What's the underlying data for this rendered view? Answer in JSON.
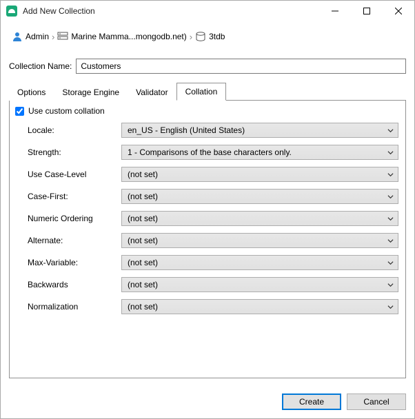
{
  "window": {
    "title": "Add New Collection"
  },
  "breadcrumb": {
    "user": "Admin",
    "server": "Marine Mamma...mongodb.net)",
    "db": "3tdb"
  },
  "nameRow": {
    "label": "Collection Name:",
    "value": "Customers"
  },
  "tabs": {
    "options": "Options",
    "storageEngine": "Storage Engine",
    "validator": "Validator",
    "collation": "Collation"
  },
  "collation": {
    "useCustom": "Use custom collation",
    "fields": {
      "locale": {
        "label": "Locale:",
        "value": "en_US - English (United States)"
      },
      "strength": {
        "label": "Strength:",
        "value": "1 - Comparisons of the base characters only."
      },
      "useCaseLevel": {
        "label": "Use Case-Level",
        "value": "(not set)"
      },
      "caseFirst": {
        "label": "Case-First:",
        "value": "(not set)"
      },
      "numericOrdering": {
        "label": "Numeric Ordering",
        "value": "(not set)"
      },
      "alternate": {
        "label": "Alternate:",
        "value": "(not set)"
      },
      "maxVariable": {
        "label": "Max-Variable:",
        "value": "(not set)"
      },
      "backwards": {
        "label": "Backwards",
        "value": "(not set)"
      },
      "normalization": {
        "label": "Normalization",
        "value": "(not set)"
      }
    }
  },
  "footer": {
    "create": "Create",
    "cancel": "Cancel"
  }
}
